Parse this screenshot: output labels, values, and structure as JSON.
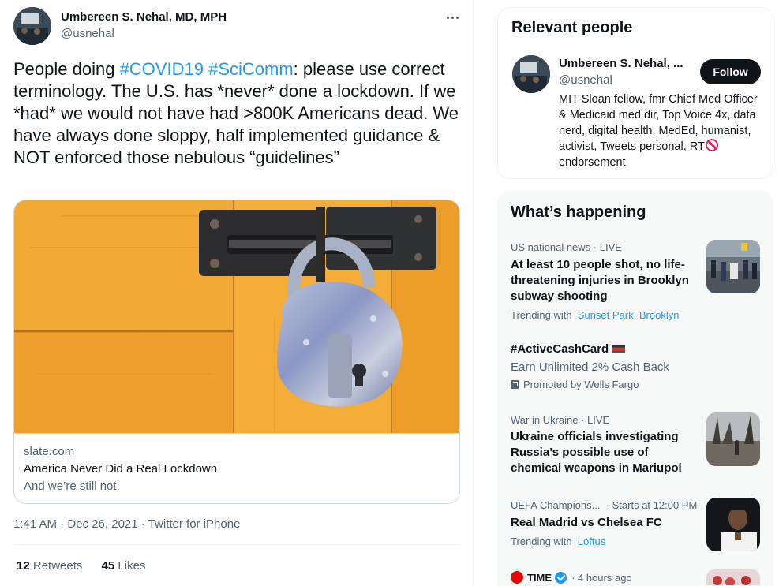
{
  "tweet": {
    "author_name": "Umbereen S. Nehal, MD, MPH",
    "author_handle": "@usnehal",
    "text_parts": {
      "p1": "People doing ",
      "tag1": "#COVID19",
      "p2": " ",
      "tag2": "#SciComm",
      "p3": ": please use correct terminology. The U.S. has *never* done a lockdown. If we *had* we would not have had >800K Americans dead. We have always done sloppy, half implemented guidance & NOT enforced those nebulous “guidelines”"
    },
    "card": {
      "domain": "slate.com",
      "title": "America Never Did a Real Lockdown",
      "description": "And we’re still not."
    },
    "timestamp": "1:41 AM · Dec 26, 2021",
    "source": "Twitter for iPhone",
    "retweets_count": "12",
    "retweets_label": "Retweets",
    "likes_count": "45",
    "likes_label": "Likes"
  },
  "relevant_people": {
    "title": "Relevant people",
    "name": "Umbereen S. Nehal, ...",
    "handle": "@usnehal",
    "follow_label": "Follow",
    "bio_before": "MIT Sloan fellow, fmr Chief Med Officer & Medicaid med dir, Top Voice 4x, data nerd, digital health, MedEd, humanist, activist, Tweets personal, RT",
    "bio_after": "endorsement"
  },
  "whats_happening": {
    "title": "What’s happening",
    "trends": [
      {
        "context": "US national news · LIVE",
        "headline": "At least 10 people shot, no life-threatening injuries in Brooklyn subway shooting",
        "trending_with_label": "Trending with",
        "link1": "Sunset Park",
        "separator": ", ",
        "link2": "Brooklyn"
      },
      {
        "headline": "#ActiveCashCard",
        "subtitle": "Earn Unlimited 2% Cash Back",
        "promoted": "Promoted by Wells Fargo"
      },
      {
        "context": "War in Ukraine · LIVE",
        "headline": "Ukraine officials investigating Russia’s possible use of chemical weapons in Mariupol"
      },
      {
        "context": "UEFA Champions...",
        "context_time": "· Starts at 12:00 PM",
        "headline": "Real Madrid vs Chelsea FC",
        "trending_with_label": "Trending with",
        "link1": "Loftus"
      },
      {
        "source": "TIME",
        "time": "· 4 hours ago"
      }
    ]
  },
  "colors": {
    "accent": "#1d9bf0",
    "text": "#0f1419",
    "muted": "#536471",
    "panel_bg": "#f7f9f9"
  }
}
